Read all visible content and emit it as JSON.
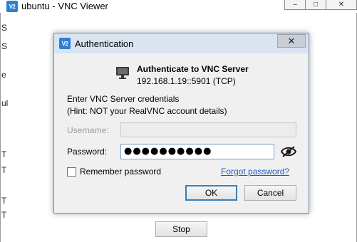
{
  "background_window": {
    "title": "ubuntu - VNC Viewer",
    "app_icon": "V2",
    "side_fragments": [
      "S",
      "S",
      "e",
      "ul",
      "T",
      "T",
      "T",
      "T"
    ],
    "stop_label": "Stop"
  },
  "dialog": {
    "title": "Authentication",
    "app_icon": "V2",
    "close_glyph": "✕",
    "server_title": "Authenticate to VNC Server",
    "server_address": "192.168.1.19::5901 (TCP)",
    "prompt_line1": "Enter VNC Server credentials",
    "prompt_line2": "(Hint: NOT your RealVNC account details)",
    "username_label": "Username:",
    "username_value": "",
    "password_label": "Password:",
    "password_value": "●●●●●●●●●●",
    "remember_label": "Remember password",
    "remember_checked": false,
    "forgot_link": "Forgot password?",
    "ok_label": "OK",
    "cancel_label": "Cancel"
  },
  "colors": {
    "titlebar": "#d9e4f1",
    "dialog_bg": "#f0f0f0",
    "link": "#1f5bbf",
    "focus_border": "#3c7fb1"
  }
}
